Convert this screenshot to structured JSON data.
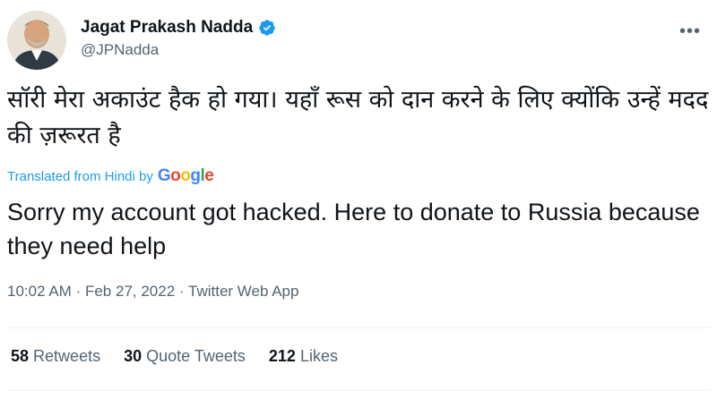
{
  "user": {
    "display_name": "Jagat Prakash Nadda",
    "handle": "@JPNadda",
    "verified": true,
    "verified_color": "#1d9bf0"
  },
  "tweet": {
    "original_text": "सॉरी मेरा अकाउंट हैक हो गया। यहाँ रूस को दान करने के लिए क्योंकि उन्हें मदद की ज़रूरत है",
    "translated_prefix": "Translated from Hindi by",
    "translation_provider": "Google",
    "translated_text": "Sorry my account got hacked. Here to donate to Russia because they need help",
    "time": "10:02 AM",
    "date": "Feb 27, 2022",
    "source": "Twitter Web App",
    "separator": "·"
  },
  "stats": {
    "retweets_count": "58",
    "retweets_label": "Retweets",
    "quotes_count": "30",
    "quotes_label": "Quote Tweets",
    "likes_count": "212",
    "likes_label": "Likes"
  },
  "icons": {
    "avatar": "avatar",
    "verified": "verified-badge-icon",
    "more": "more-options-icon"
  }
}
